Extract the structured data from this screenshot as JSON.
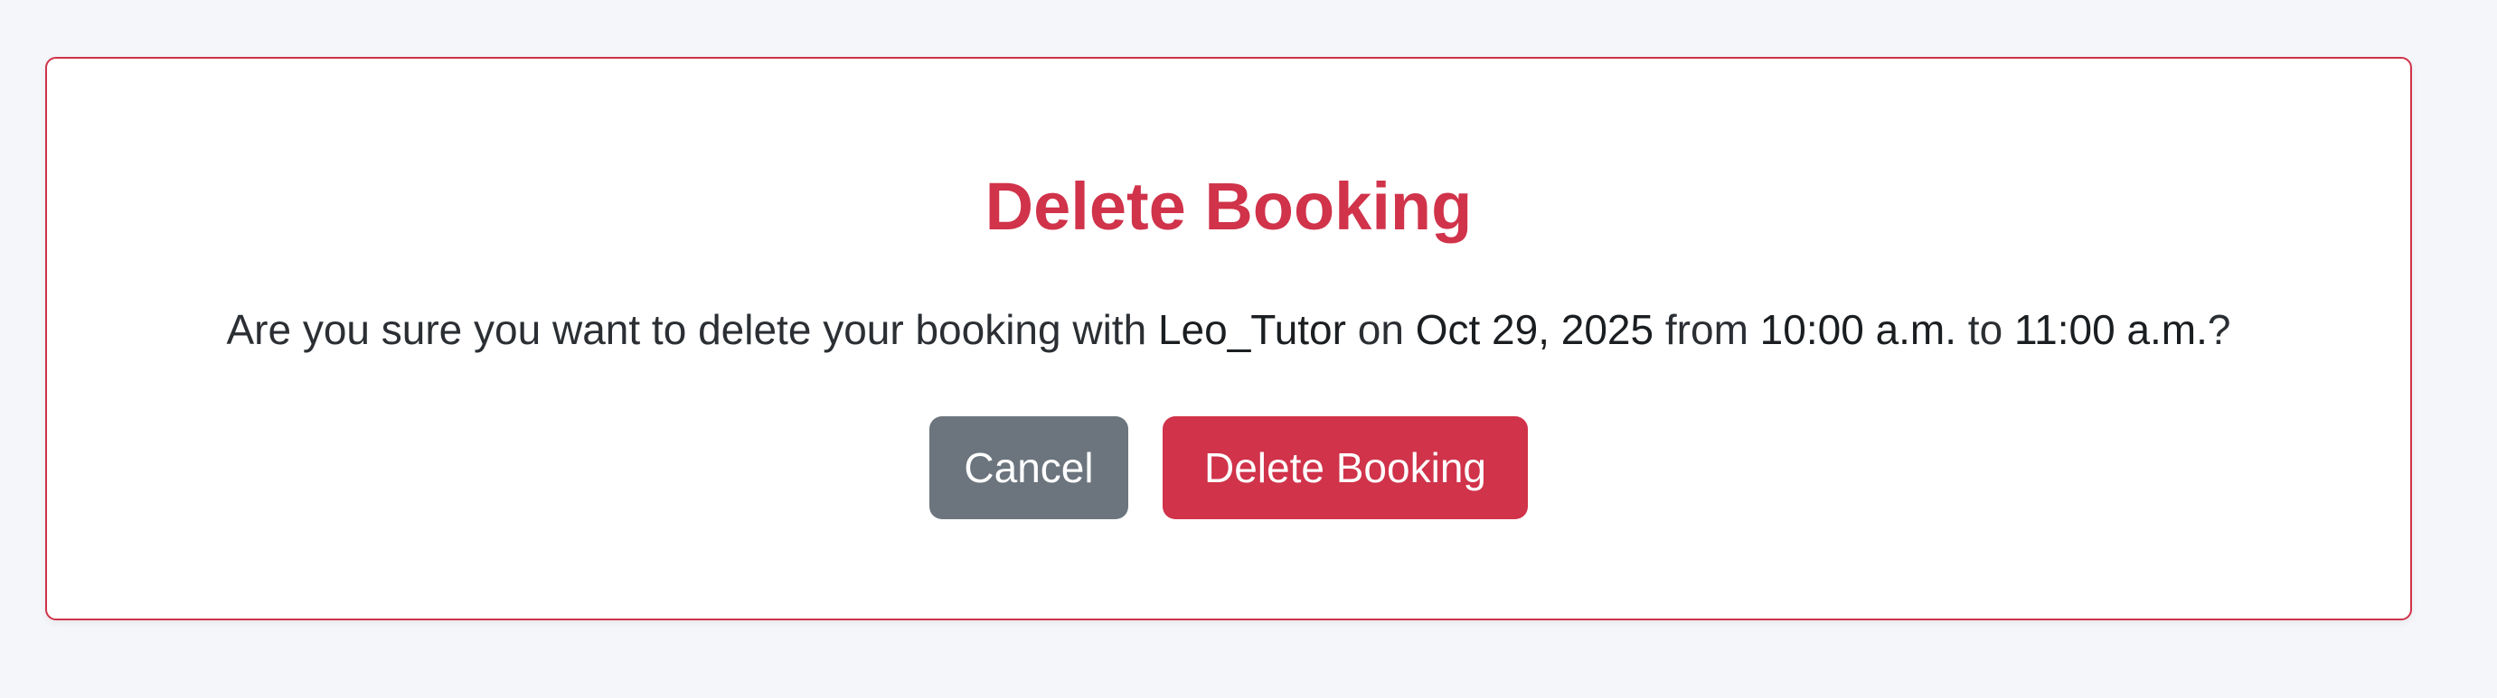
{
  "dialog": {
    "title": "Delete Booking",
    "message": {
      "prefix": "Are you sure you want to delete your booking with ",
      "tutor": "Leo_Tutor",
      "on_text": " on ",
      "date": "Oct 29, 2025",
      "from_text": " from ",
      "start_time": "10:00 a.m.",
      "to_text": " to ",
      "end_time": "11:00 a.m.",
      "suffix": "?"
    },
    "buttons": {
      "cancel_label": "Cancel",
      "delete_label": "Delete Booking"
    }
  },
  "colors": {
    "accent": "#d0334a",
    "secondary": "#6c757d",
    "background": "#f5f6fa"
  }
}
